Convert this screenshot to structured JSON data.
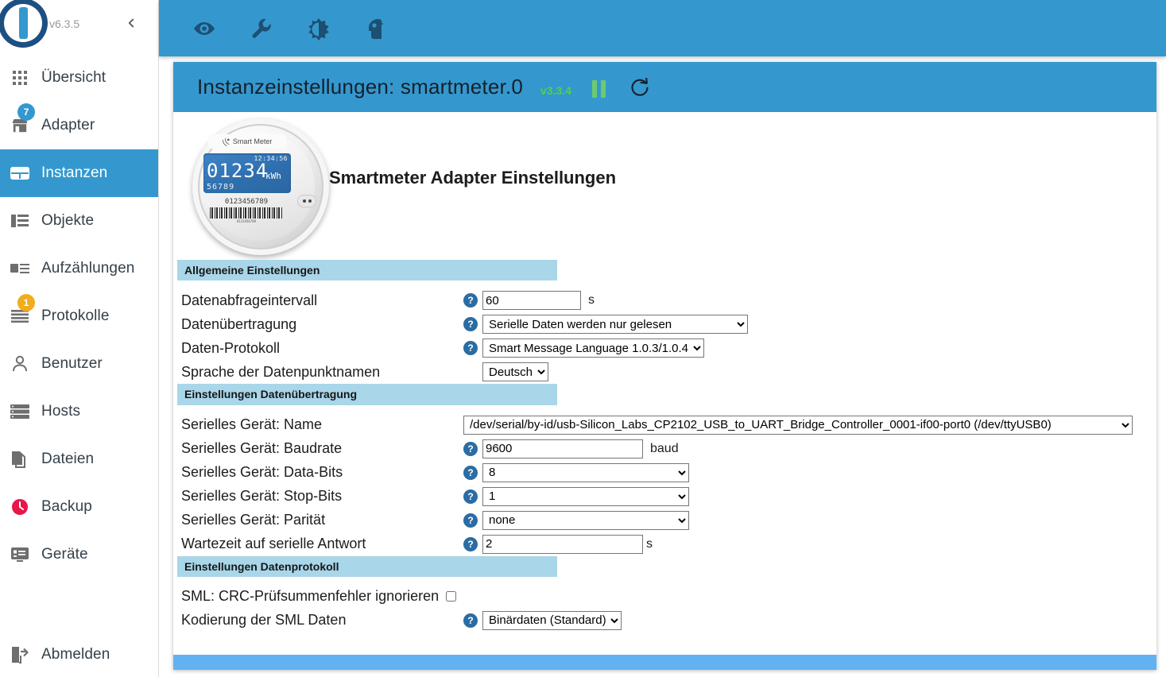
{
  "sidebar": {
    "version": "v6.3.5",
    "collapse_icon": "chevron-left-icon",
    "items": [
      {
        "label": "Übersicht",
        "icon": "grid-icon",
        "badge": null,
        "active": false
      },
      {
        "label": "Adapter",
        "icon": "store-icon",
        "badge": "7",
        "badge_color": "blue",
        "active": false
      },
      {
        "label": "Instanzen",
        "icon": "instances-icon",
        "badge": null,
        "active": true
      },
      {
        "label": "Objekte",
        "icon": "objects-icon",
        "badge": null,
        "active": false
      },
      {
        "label": "Aufzählungen",
        "icon": "enums-icon",
        "badge": null,
        "active": false
      },
      {
        "label": "Protokolle",
        "icon": "log-icon",
        "badge": "1",
        "badge_color": "amber",
        "active": false
      },
      {
        "label": "Benutzer",
        "icon": "user-icon",
        "badge": null,
        "active": false
      },
      {
        "label": "Hosts",
        "icon": "hosts-icon",
        "badge": null,
        "active": false
      },
      {
        "label": "Dateien",
        "icon": "files-icon",
        "badge": null,
        "active": false
      },
      {
        "label": "Backup",
        "icon": "backup-clock-icon",
        "badge": null,
        "active": false
      },
      {
        "label": "Geräte",
        "icon": "devices-icon",
        "badge": null,
        "active": false
      }
    ],
    "logout": {
      "label": "Abmelden",
      "icon": "logout-icon"
    }
  },
  "toolbar": {
    "icons": [
      {
        "name": "eye-icon"
      },
      {
        "name": "wrench-icon"
      },
      {
        "name": "contrast-icon"
      },
      {
        "name": "expert-head-icon"
      }
    ]
  },
  "panel": {
    "title": "Instanzeinstellungen: smartmeter.0",
    "adapter_version": "v3.3.4",
    "pause_icon": "pause-icon",
    "refresh_icon": "refresh-icon",
    "content_title": "Smartmeter Adapter Einstellungen"
  },
  "meter_image": {
    "brand": "Smart Meter",
    "lcd_time": "12:34:56",
    "lcd_value": "01234",
    "lcd_unit": "kWh",
    "lcd_sub": "56789",
    "serial": "0123456789",
    "barcode_text": "0123456789"
  },
  "sections": {
    "general": {
      "header": "Allgemeine Einstellungen",
      "rows": {
        "poll_interval": {
          "label": "Datenabfrageintervall",
          "value": "60",
          "unit": "s",
          "help": "?"
        },
        "transmission": {
          "label": "Datenübertragung",
          "value": "Serielle Daten werden nur gelesen",
          "options": [
            "Serielle Daten werden nur gelesen"
          ],
          "help": "?"
        },
        "protocol": {
          "label": "Daten-Protokoll",
          "value": "Smart Message Language 1.0.3/1.0.4",
          "options": [
            "Smart Message Language 1.0.3/1.0.4"
          ],
          "help": "?"
        },
        "language": {
          "label": "Sprache der Datenpunktnamen",
          "value": "Deutsch",
          "options": [
            "Deutsch"
          ]
        }
      }
    },
    "transfer": {
      "header": "Einstellungen Datenübertragung",
      "rows": {
        "device_name": {
          "label": "Serielles Gerät: Name",
          "value": "/dev/serial/by-id/usb-Silicon_Labs_CP2102_USB_to_UART_Bridge_Controller_0001-if00-port0 (/dev/ttyUSB0)",
          "options": [
            "/dev/serial/by-id/usb-Silicon_Labs_CP2102_USB_to_UART_Bridge_Controller_0001-if00-port0 (/dev/ttyUSB0)"
          ]
        },
        "baudrate": {
          "label": "Serielles Gerät: Baudrate",
          "value": "9600",
          "unit": "baud",
          "help": "?"
        },
        "data_bits": {
          "label": "Serielles Gerät: Data-Bits",
          "value": "8",
          "options": [
            "8"
          ],
          "help": "?"
        },
        "stop_bits": {
          "label": "Serielles Gerät: Stop-Bits",
          "value": "1",
          "options": [
            "1"
          ],
          "help": "?"
        },
        "parity": {
          "label": "Serielles Gerät: Parität",
          "value": "none",
          "options": [
            "none"
          ],
          "help": "?"
        },
        "wait_time": {
          "label": "Wartezeit auf serielle Antwort",
          "value": "2",
          "unit": "s",
          "help": "?"
        }
      }
    },
    "protocol": {
      "header": "Einstellungen Datenprotokoll",
      "rows": {
        "crc_ignore": {
          "label": "SML: CRC-Prüfsummenfehler ignorieren",
          "checked": false
        },
        "encoding": {
          "label": "Kodierung der SML Daten",
          "value": "Binärdaten (Standard)",
          "options": [
            "Binärdaten (Standard)"
          ],
          "help": "?"
        }
      }
    }
  },
  "colors": {
    "accent": "#3498ce",
    "section_header_bg": "#a9d6e9",
    "footer_bar": "#62b2f2",
    "badge_blue": "#3498ce",
    "badge_amber": "#f0ad1e",
    "version_green": "#4dd24d"
  }
}
